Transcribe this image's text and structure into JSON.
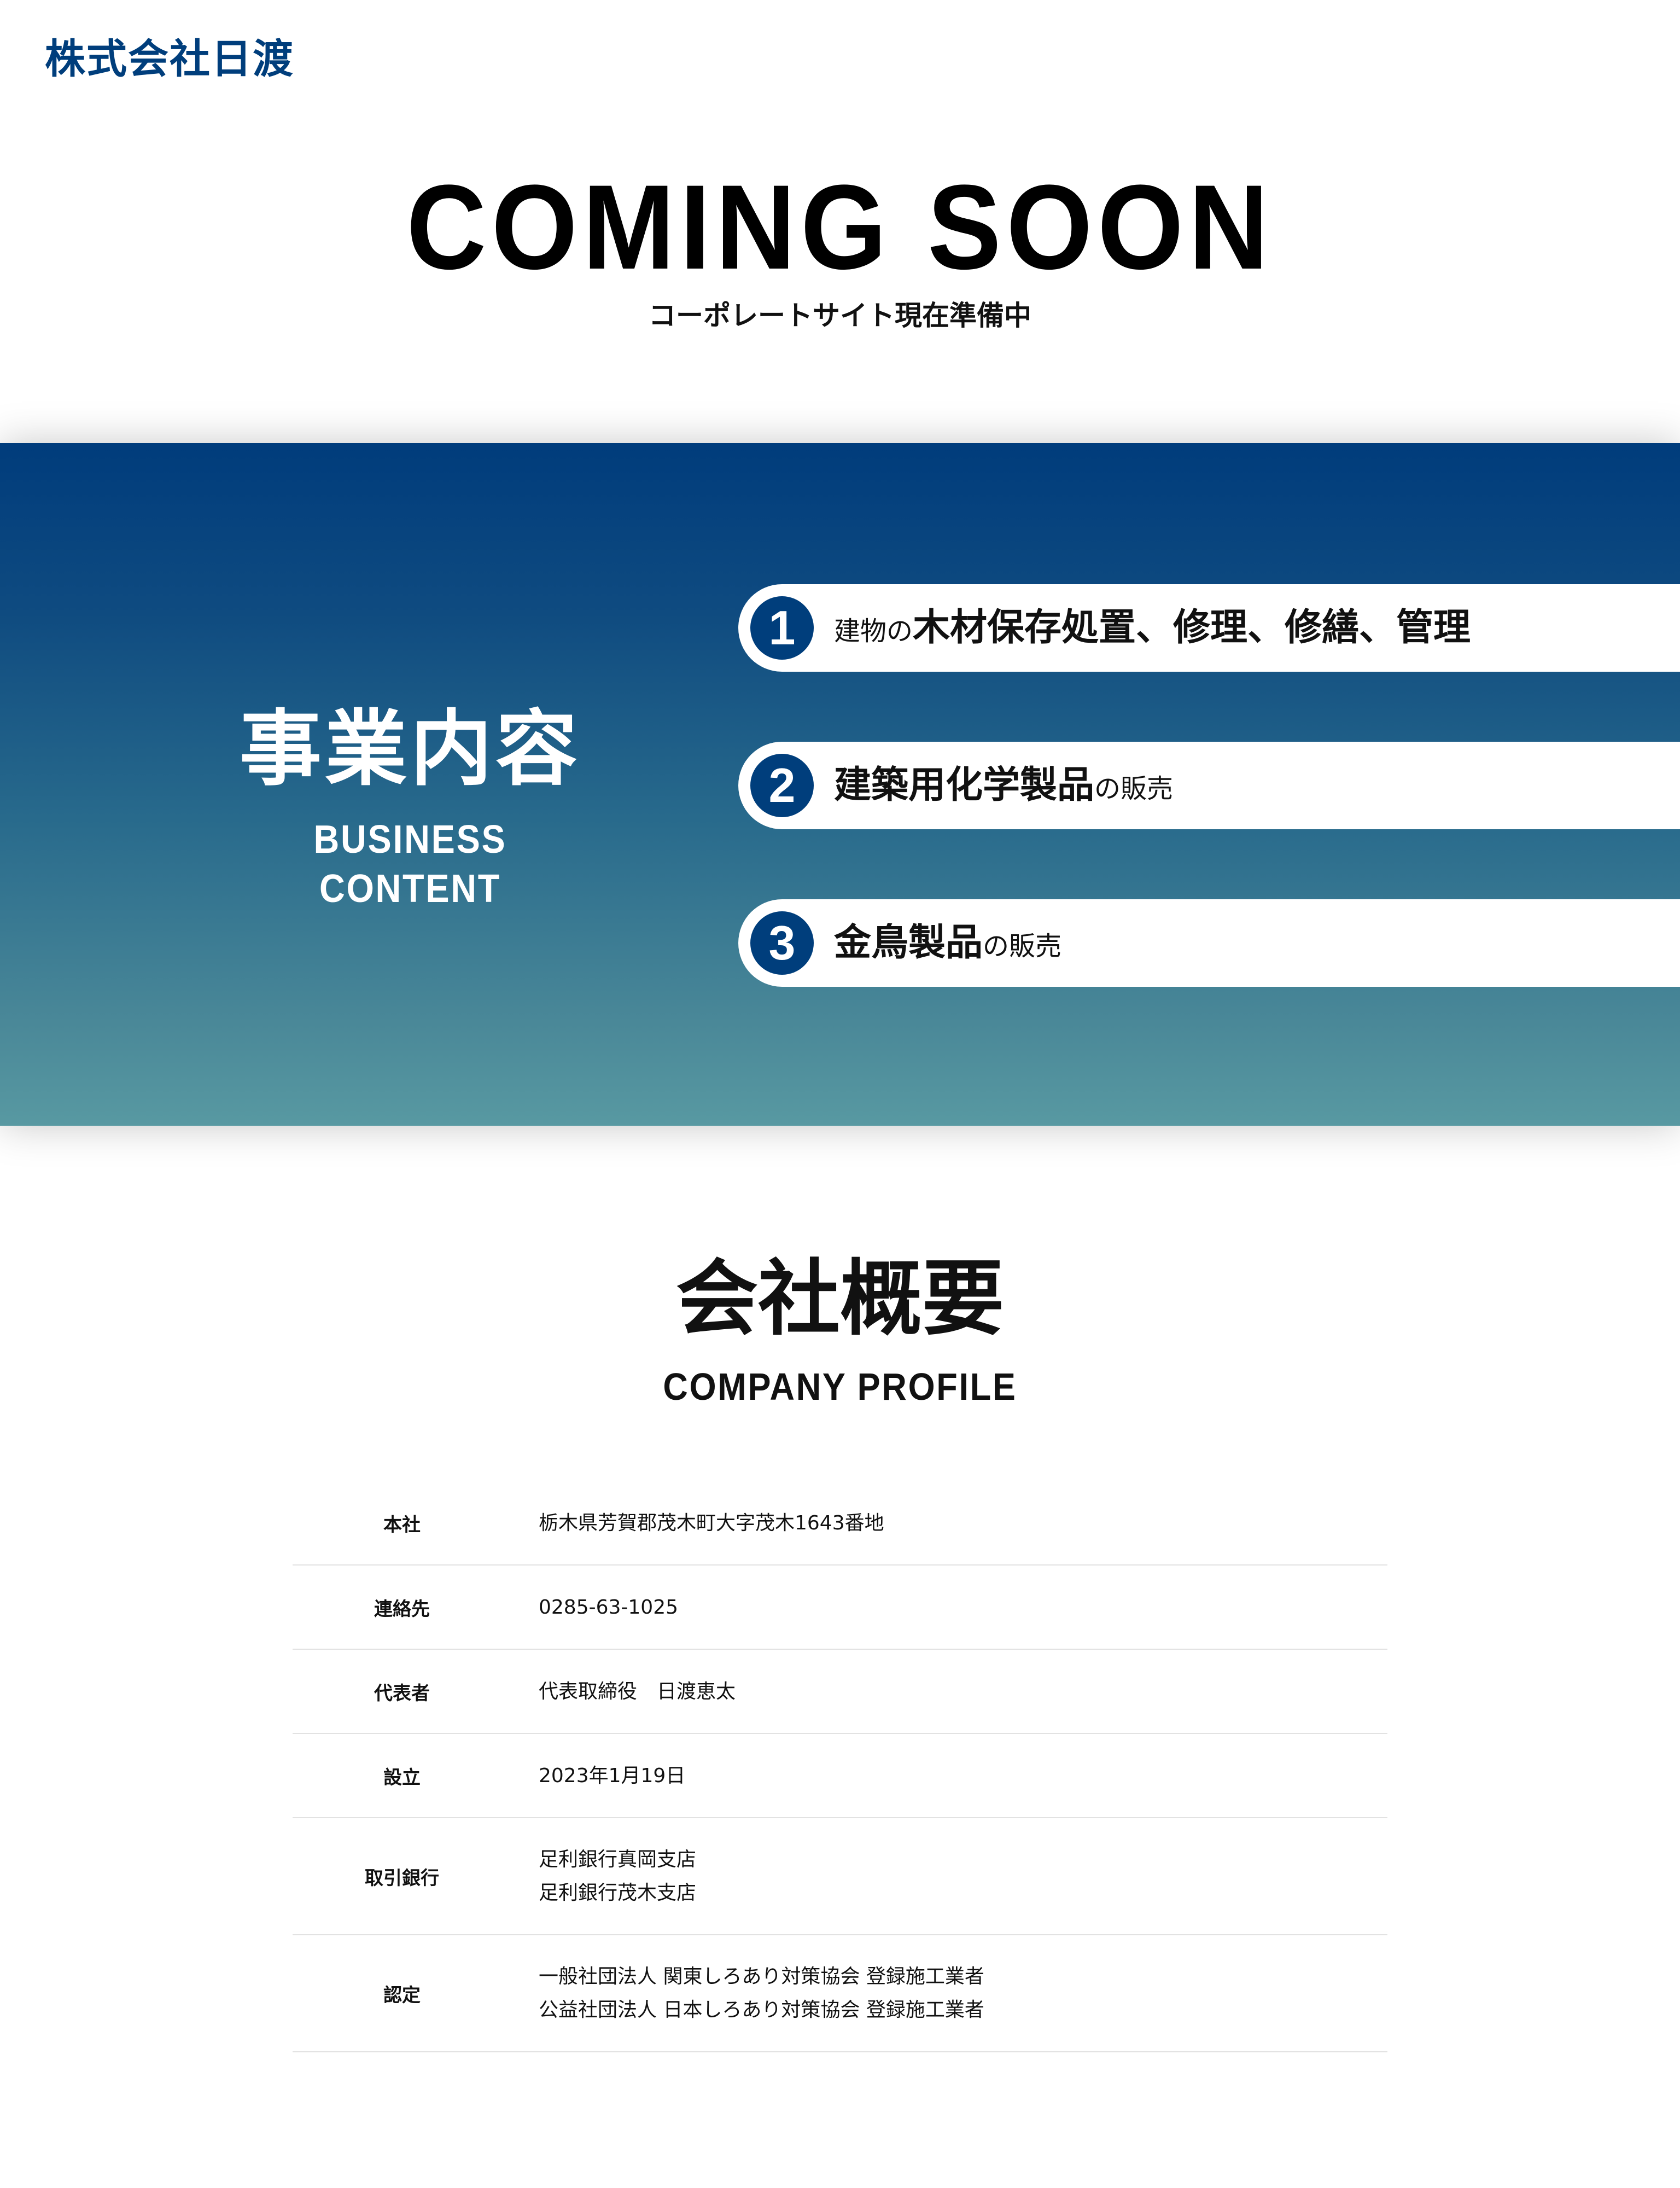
{
  "header": {
    "logo": "株式会社日渡"
  },
  "hero": {
    "title": "COMING SOON",
    "subtitle": "コーポレートサイト現在準備中"
  },
  "business": {
    "title": "事業内容",
    "subtitle": "BUSINESS CONTENT",
    "items": [
      {
        "number": "1",
        "prefix": "建物の",
        "main": "木材保存処置、修理、修繕、管理",
        "suffix": ""
      },
      {
        "number": "2",
        "prefix": "",
        "main": "建築用化学製品",
        "suffix": "の販売"
      },
      {
        "number": "3",
        "prefix": "",
        "main": "金鳥製品",
        "suffix": "の販売"
      }
    ]
  },
  "profile": {
    "title": "会社概要",
    "subtitle": "COMPANY PROFILE",
    "rows": [
      {
        "label": "本社",
        "lines": [
          "栃木県芳賀郡茂木町大字茂木1643番地"
        ]
      },
      {
        "label": "連絡先",
        "lines": [
          "0285-63-1025"
        ]
      },
      {
        "label": "代表者",
        "lines": [
          "代表取締役　日渡恵太"
        ]
      },
      {
        "label": "設立",
        "lines": [
          "2023年1月19日"
        ]
      },
      {
        "label": "取引銀行",
        "lines": [
          "足利銀行真岡支店",
          "足利銀行茂木支店"
        ]
      },
      {
        "label": "認定",
        "lines": [
          "一般社団法人 関東しろあり対策協会 登録施工業者",
          "公益社団法人 日本しろあり対策協会 登録施工業者"
        ]
      }
    ]
  },
  "colors": {
    "brand": "#003e7c",
    "gradient_top": "#003c7c",
    "gradient_bottom": "#5899a2"
  }
}
